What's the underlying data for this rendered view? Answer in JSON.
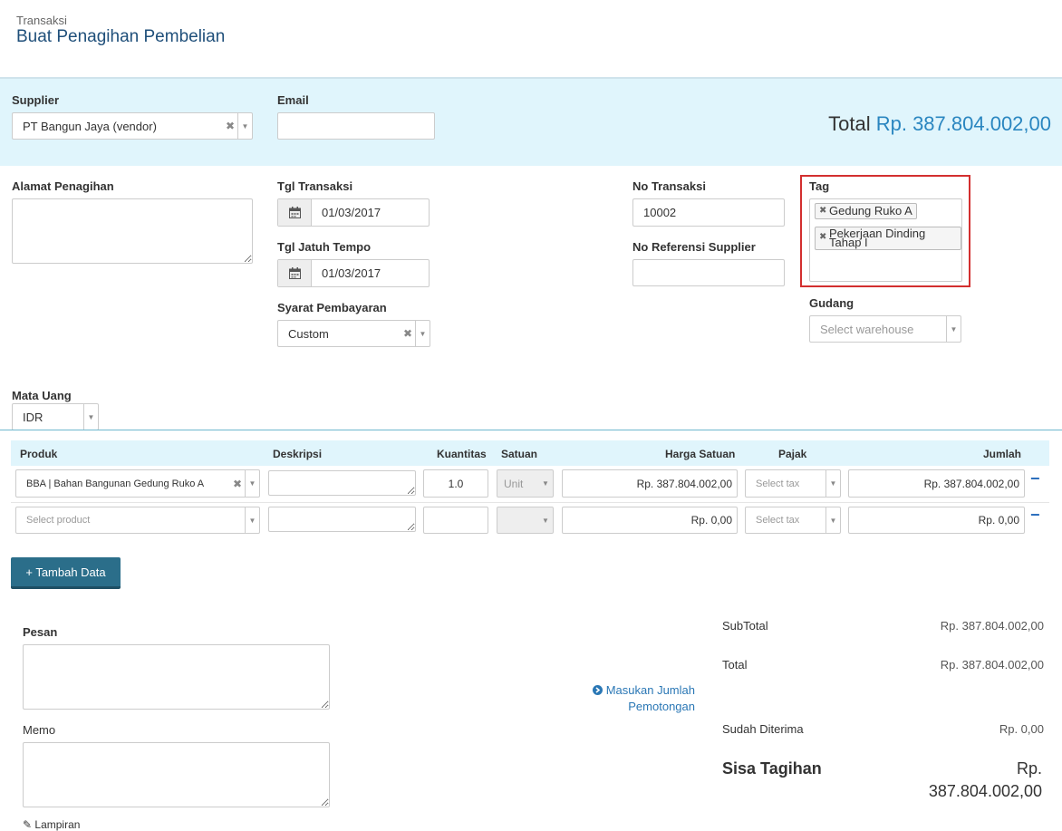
{
  "header": {
    "breadcrumb": "Transaksi",
    "title": "Buat Penagihan Pembelian"
  },
  "supplier": {
    "label": "Supplier",
    "value": "PT Bangun Jaya (vendor)"
  },
  "email": {
    "label": "Email",
    "value": ""
  },
  "total": {
    "label": "Total",
    "value": "Rp. 387.804.002,00"
  },
  "alamat": {
    "label": "Alamat Penagihan",
    "value": ""
  },
  "tgl_transaksi": {
    "label": "Tgl Transaksi",
    "value": "01/03/2017"
  },
  "tgl_jatuh_tempo": {
    "label": "Tgl Jatuh Tempo",
    "value": "01/03/2017"
  },
  "syarat": {
    "label": "Syarat Pembayaran",
    "value": "Custom"
  },
  "no_transaksi": {
    "label": "No Transaksi",
    "value": "10002"
  },
  "no_referensi": {
    "label": "No Referensi Supplier",
    "value": ""
  },
  "tag": {
    "label": "Tag",
    "items": [
      "Gedung Ruko A",
      "Pekerjaan Dinding Tahap I"
    ]
  },
  "gudang": {
    "label": "Gudang",
    "placeholder": "Select warehouse"
  },
  "mata_uang": {
    "label": "Mata Uang",
    "value": "IDR"
  },
  "table": {
    "headers": {
      "produk": "Produk",
      "deskripsi": "Deskripsi",
      "kuantitas": "Kuantitas",
      "satuan": "Satuan",
      "harga": "Harga Satuan",
      "pajak": "Pajak",
      "jumlah": "Jumlah"
    },
    "rows": [
      {
        "produk": "BBA | Bahan Bangunan Gedung Ruko A",
        "deskripsi": "",
        "kuantitas": "1.0",
        "satuan": "Unit",
        "harga": "Rp. 387.804.002,00",
        "pajak_placeholder": "Select tax",
        "jumlah": "Rp. 387.804.002,00"
      },
      {
        "produk_placeholder": "Select product",
        "deskripsi": "",
        "kuantitas": "",
        "satuan": "",
        "harga": "Rp. 0,00",
        "pajak_placeholder": "Select tax",
        "jumlah": "Rp. 0,00"
      }
    ],
    "remove_symbol": "−"
  },
  "add_button": "+ Tambah Data",
  "pesan": {
    "label": "Pesan",
    "value": ""
  },
  "memo": {
    "label": "Memo",
    "value": ""
  },
  "lampiran": "Lampiran",
  "pemotongan_link": {
    "line1": "Masukan Jumlah",
    "line2": "Pemotongan"
  },
  "summary": {
    "subtotal_label": "SubTotal",
    "subtotal_value": "Rp. 387.804.002,00",
    "total_label": "Total",
    "total_value": "Rp. 387.804.002,00",
    "sudah_label": "Sudah Diterima",
    "sudah_value": "Rp. 0,00",
    "sisa_label": "Sisa Tagihan",
    "sisa_value_line1": "Rp.",
    "sisa_value_line2": "387.804.002,00"
  },
  "colors": {
    "accent": "#2a86c0",
    "band": "#e0f5fc",
    "button": "#2b6e8a",
    "highlight": "#d32f2f",
    "title": "#1f4f7a"
  }
}
